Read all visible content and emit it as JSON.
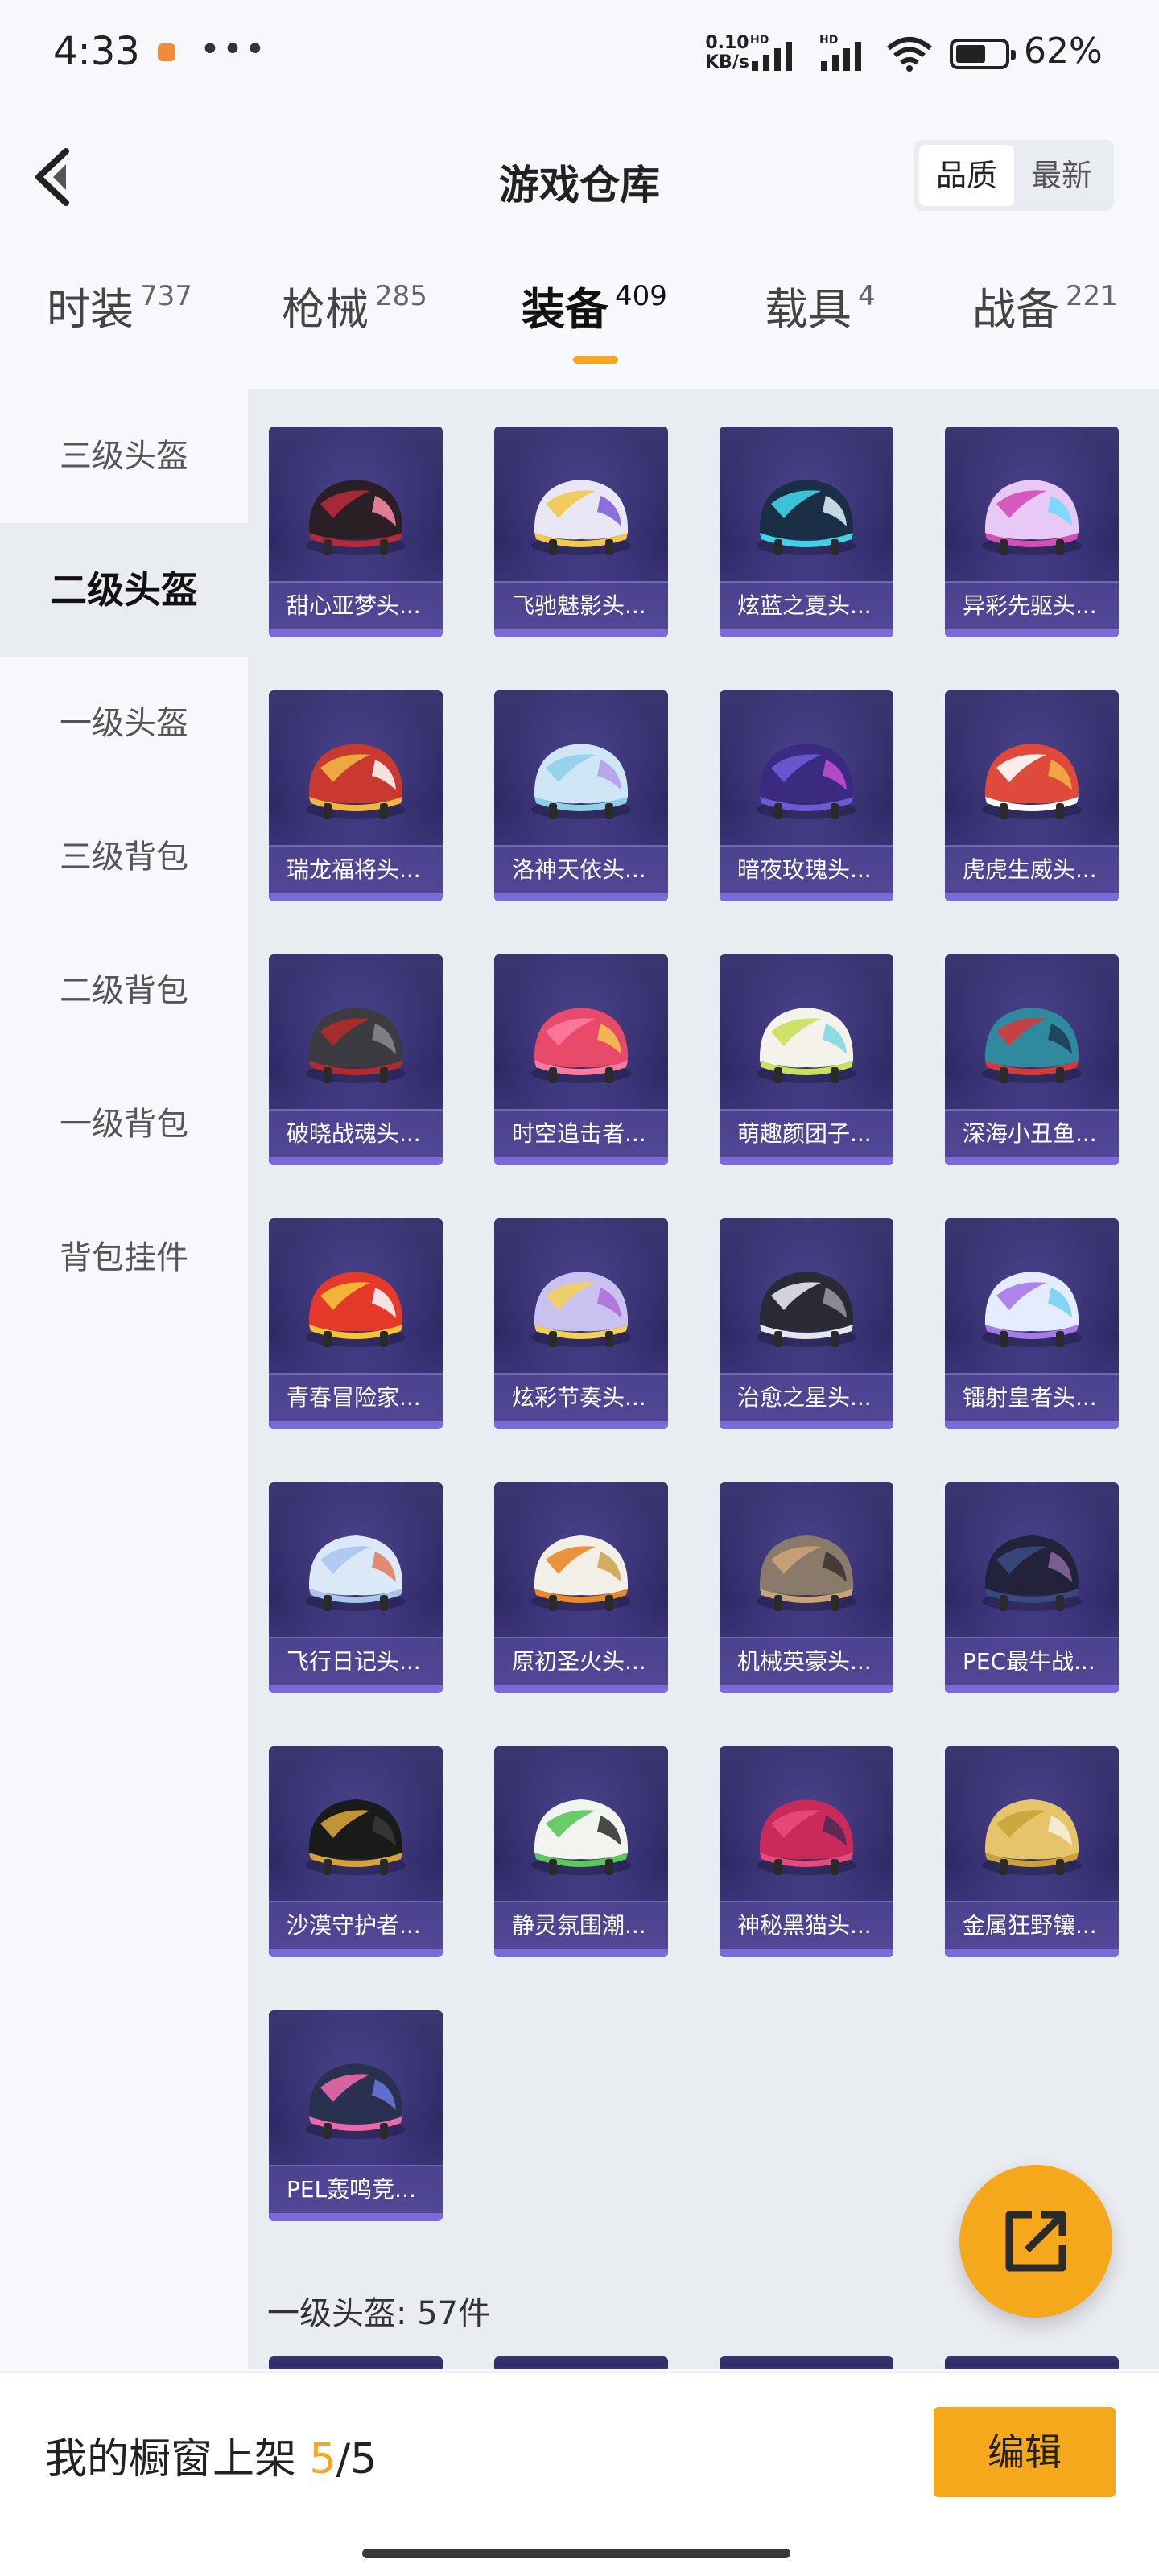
{
  "status_bar": {
    "time": "4:33",
    "more": "•••",
    "net_speed_value": "0.10",
    "net_speed_unit": "KB/s",
    "signal_label_1": "HD",
    "signal_label_2": "HD",
    "battery": "62%",
    "battery_level": 0.62
  },
  "header": {
    "title": "游戏仓库",
    "sort_options": [
      "品质",
      "最新"
    ],
    "active_sort": "品质"
  },
  "tabs": [
    {
      "label": "时装",
      "count": "737"
    },
    {
      "label": "枪械",
      "count": "285"
    },
    {
      "label": "装备",
      "count": "409",
      "active": true
    },
    {
      "label": "载具",
      "count": "4"
    },
    {
      "label": "战备",
      "count": "221"
    }
  ],
  "sidebar": {
    "items": [
      {
        "label": "三级头盔"
      },
      {
        "label": "二级头盔",
        "active": true
      },
      {
        "label": "一级头盔"
      },
      {
        "label": "三级背包"
      },
      {
        "label": "二级背包"
      },
      {
        "label": "一级背包"
      },
      {
        "label": "背包挂件"
      }
    ]
  },
  "items": [
    {
      "name": "甜心亚梦头...",
      "icon": "helmet-icon",
      "colors": [
        "#2a1f25",
        "#b32a3a",
        "#ff8fa6"
      ]
    },
    {
      "name": "飞驰魅影头...",
      "icon": "helmet-icon",
      "colors": [
        "#e9e7f5",
        "#f2c94c",
        "#7a5ad6"
      ]
    },
    {
      "name": "炫蓝之夏头...",
      "icon": "helmet-icon",
      "colors": [
        "#1a2f45",
        "#3fd3e6",
        "#e0f7ff"
      ]
    },
    {
      "name": "异彩先驱头...",
      "icon": "helmet-icon",
      "colors": [
        "#e8c8f5",
        "#d24fb5",
        "#6ad9ff"
      ]
    },
    {
      "name": "瑞龙福将头...",
      "icon": "helmet-icon",
      "colors": [
        "#c9392f",
        "#f2b544",
        "#ffffff"
      ]
    },
    {
      "name": "洛神天依头...",
      "icon": "helmet-icon",
      "colors": [
        "#cfe6f7",
        "#8fd0e8",
        "#b49ae8"
      ]
    },
    {
      "name": "暗夜玫瑰头...",
      "icon": "helmet-icon",
      "colors": [
        "#3a2a80",
        "#6f5ad6",
        "#c94fd6"
      ]
    },
    {
      "name": "虎虎生威头...",
      "icon": "helmet-icon",
      "colors": [
        "#e04a3b",
        "#ffffff",
        "#f2b544"
      ]
    },
    {
      "name": "破晓战魂头...",
      "icon": "helmet-icon",
      "colors": [
        "#3b3b40",
        "#b02c2c",
        "#8a8a90"
      ]
    },
    {
      "name": "时空追击者...",
      "icon": "helmet-icon",
      "colors": [
        "#e84a6a",
        "#ff7aa0",
        "#f2c94c"
      ]
    },
    {
      "name": "萌趣颜团子...",
      "icon": "helmet-icon",
      "colors": [
        "#f4f2ea",
        "#c8e05a",
        "#7ad6e0"
      ]
    },
    {
      "name": "深海小丑鱼...",
      "icon": "helmet-icon",
      "colors": [
        "#2f8aa0",
        "#d43a3a",
        "#1c3a55"
      ]
    },
    {
      "name": "青春冒险家...",
      "icon": "helmet-icon",
      "colors": [
        "#e53a2a",
        "#f5c23a",
        "#ffffff"
      ]
    },
    {
      "name": "炫彩节奏头...",
      "icon": "helmet-icon",
      "colors": [
        "#c9c2f0",
        "#f2d05a",
        "#b06ad6"
      ]
    },
    {
      "name": "治愈之星头...",
      "icon": "helmet-icon",
      "colors": [
        "#2a2a35",
        "#e6e6ee",
        "#9a9aa6"
      ]
    },
    {
      "name": "镭射皇者头...",
      "icon": "helmet-icon",
      "colors": [
        "#e6ecff",
        "#a67ae8",
        "#6fd0f0"
      ]
    },
    {
      "name": "飞行日记头...",
      "icon": "helmet-icon",
      "colors": [
        "#dbe8f7",
        "#a8c6ec",
        "#e07a5a"
      ]
    },
    {
      "name": "原初圣火头...",
      "icon": "helmet-icon",
      "colors": [
        "#f2f0e6",
        "#e8892a",
        "#c9a24a"
      ]
    },
    {
      "name": "机械英豪头...",
      "icon": "helmet-icon",
      "colors": [
        "#8a7a6a",
        "#c9a27a",
        "#3a3030"
      ]
    },
    {
      "name": "PEC最牛战...",
      "icon": "helmet-icon",
      "colors": [
        "#22223a",
        "#3a4a80",
        "#8a6aa0"
      ]
    },
    {
      "name": "沙漠守护者...",
      "icon": "helmet-icon",
      "colors": [
        "#1a1a1a",
        "#d4a23a",
        "#3a3a3a"
      ]
    },
    {
      "name": "静灵氛围潮...",
      "icon": "helmet-icon",
      "colors": [
        "#f2f4f0",
        "#5ac85a",
        "#2a2a2a"
      ]
    },
    {
      "name": "神秘黑猫头...",
      "icon": "helmet-icon",
      "colors": [
        "#c92a5a",
        "#e84a7a",
        "#4a2a55"
      ]
    },
    {
      "name": "金属狂野镶...",
      "icon": "helmet-icon",
      "colors": [
        "#e6c56a",
        "#c9a23a",
        "#f5f0e0"
      ]
    },
    {
      "name": "PEL轰鸣竞...",
      "icon": "helmet-icon",
      "colors": [
        "#2a3050",
        "#e86aa8",
        "#6a7ae0"
      ]
    }
  ],
  "section_label": "一级头盔: 57件",
  "fab": {
    "icon": "share-export-icon"
  },
  "bottom_bar": {
    "label": "我的橱窗上架",
    "current": "5",
    "separator": "/",
    "total": "5",
    "edit_label": "编辑"
  },
  "colors": {
    "accent": "#f5a623",
    "card_bg": "#2f2a66"
  }
}
